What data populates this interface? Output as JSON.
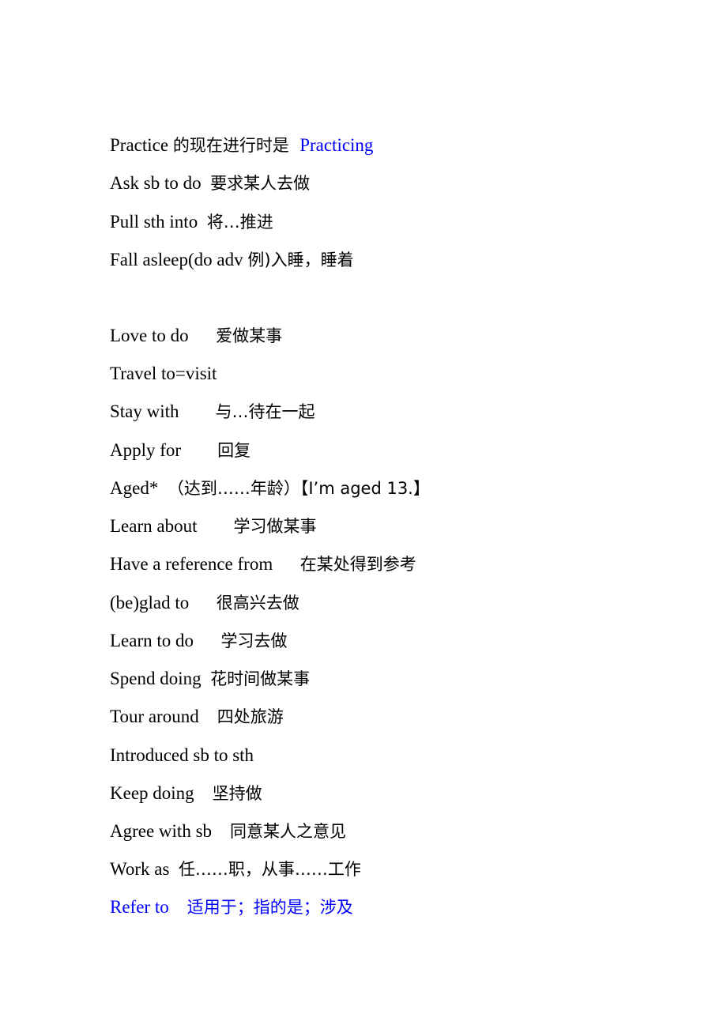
{
  "document": {
    "lines": [
      {
        "en": "Practice ",
        "cn": "的现在进行时是  ",
        "extra": "Practicing",
        "extra_color": "#0000ff"
      },
      {
        "en": "Ask sb to do  ",
        "cn": "要求某人去做"
      },
      {
        "en": "Pull sth into  ",
        "cn": "将…推进"
      },
      {
        "en": "Fall asleep(do adv ",
        "cn": "例)入睡，睡着"
      },
      {
        "en": "Love to do      ",
        "cn": "爱做某事"
      },
      {
        "en": "Travel to=visit",
        "cn": ""
      },
      {
        "en": "Stay with        ",
        "cn": "与…待在一起"
      },
      {
        "en": "Apply for        ",
        "cn": "回复"
      },
      {
        "en": "Aged*  ",
        "cn": "（达到……年龄）【I’m aged 13.】"
      },
      {
        "en": "Learn about        ",
        "cn": "学习做某事"
      },
      {
        "en": "Have a reference from      ",
        "cn": "在某处得到参考"
      },
      {
        "en": "(be)glad to      ",
        "cn": "很高兴去做"
      },
      {
        "en": "Learn to do      ",
        "cn": "学习去做"
      },
      {
        "en": "Spend doing  ",
        "cn": "花时间做某事"
      },
      {
        "en": "Tour around    ",
        "cn": "四处旅游"
      },
      {
        "en": "Introduced sb to sth",
        "cn": ""
      },
      {
        "en": "Keep doing    ",
        "cn": "坚持做"
      },
      {
        "en": "Agree with sb    ",
        "cn": "同意某人之意见"
      },
      {
        "en": "Work as  ",
        "cn": "任……职，从事……工作"
      },
      {
        "en": "Refer to    ",
        "cn": "适用于；指的是；涉及",
        "color": "#0000ff"
      }
    ]
  }
}
